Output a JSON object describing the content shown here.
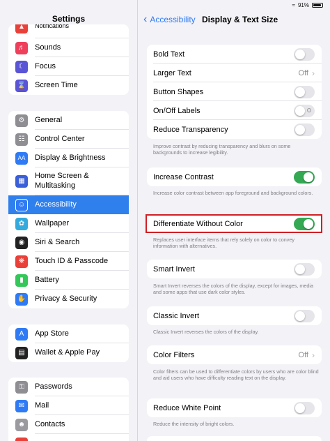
{
  "status": {
    "battery": "91%"
  },
  "sidebar": {
    "title": "Settings",
    "groups": [
      {
        "items": [
          {
            "label": "Notifications",
            "icon": "bell-icon",
            "color": "#e9403a"
          },
          {
            "label": "Sounds",
            "icon": "speaker-icon",
            "color": "#ee3f5b"
          },
          {
            "label": "Focus",
            "icon": "moon-icon",
            "color": "#5a54d6"
          },
          {
            "label": "Screen Time",
            "icon": "hourglass-icon",
            "color": "#5a54d6"
          }
        ]
      },
      {
        "items": [
          {
            "label": "General",
            "icon": "gear-icon",
            "color": "#8e8e93"
          },
          {
            "label": "Control Center",
            "icon": "sliders-icon",
            "color": "#8e8e93"
          },
          {
            "label": "Display & Brightness",
            "icon": "text-size-icon",
            "color": "#2f7bf5"
          },
          {
            "label": "Home Screen & Multitasking",
            "icon": "grid-icon",
            "color": "#3b5fd9"
          },
          {
            "label": "Accessibility",
            "icon": "accessibility-icon",
            "color": "#2f7bf5",
            "selected": true
          },
          {
            "label": "Wallpaper",
            "icon": "flower-icon",
            "color": "#34aadc"
          },
          {
            "label": "Siri & Search",
            "icon": "siri-icon",
            "color": "#222222"
          },
          {
            "label": "Touch ID & Passcode",
            "icon": "fingerprint-icon",
            "color": "#e9403a"
          },
          {
            "label": "Battery",
            "icon": "battery-icon",
            "color": "#34c759"
          },
          {
            "label": "Privacy & Security",
            "icon": "hand-icon",
            "color": "#2f7bf5"
          }
        ]
      },
      {
        "items": [
          {
            "label": "App Store",
            "icon": "app-store-icon",
            "color": "#2f7bf5"
          },
          {
            "label": "Wallet & Apple Pay",
            "icon": "wallet-icon",
            "color": "#222222"
          }
        ]
      },
      {
        "items": [
          {
            "label": "Passwords",
            "icon": "key-icon",
            "color": "#8e8e93"
          },
          {
            "label": "Mail",
            "icon": "mail-icon",
            "color": "#2f7bf5"
          },
          {
            "label": "Contacts",
            "icon": "contacts-icon",
            "color": "#9a9a9f"
          },
          {
            "label": "",
            "icon": "calendar-icon",
            "color": "#e9403a"
          }
        ]
      }
    ]
  },
  "nav": {
    "back_label": "Accessibility",
    "title": "Display & Text Size"
  },
  "detail": {
    "group1": {
      "rows": [
        {
          "label": "Bold Text",
          "type": "toggle",
          "on": false
        },
        {
          "label": "Larger Text",
          "type": "value",
          "value": "Off"
        },
        {
          "label": "Button Shapes",
          "type": "toggle",
          "on": false
        },
        {
          "label": "On/Off Labels",
          "type": "toggle",
          "on": false
        },
        {
          "label": "Reduce Transparency",
          "type": "toggle",
          "on": false
        }
      ],
      "note": "Improve contrast by reducing transparency and blurs on some backgrounds to increase legibility."
    },
    "increase_contrast": {
      "label": "Increase Contrast",
      "on": true,
      "note": "Increase color contrast between app foreground and background colors."
    },
    "differentiate": {
      "label": "Differentiate Without Color",
      "on": true,
      "note": "Replaces user interface items that rely solely on color to convey information with alternatives."
    },
    "smart_invert": {
      "label": "Smart Invert",
      "on": false,
      "note": "Smart Invert reverses the colors of the display, except for images, media and some apps that use dark color styles."
    },
    "classic_invert": {
      "label": "Classic Invert",
      "on": false,
      "note": "Classic Invert reverses the colors of the display."
    },
    "color_filters": {
      "label": "Color Filters",
      "value": "Off",
      "note": "Color filters can be used to differentiate colors by users who are color blind and aid users who have difficulty reading text on the display."
    },
    "reduce_white_point": {
      "label": "Reduce White Point",
      "on": false,
      "note": "Reduce the intensity of bright colors."
    }
  }
}
